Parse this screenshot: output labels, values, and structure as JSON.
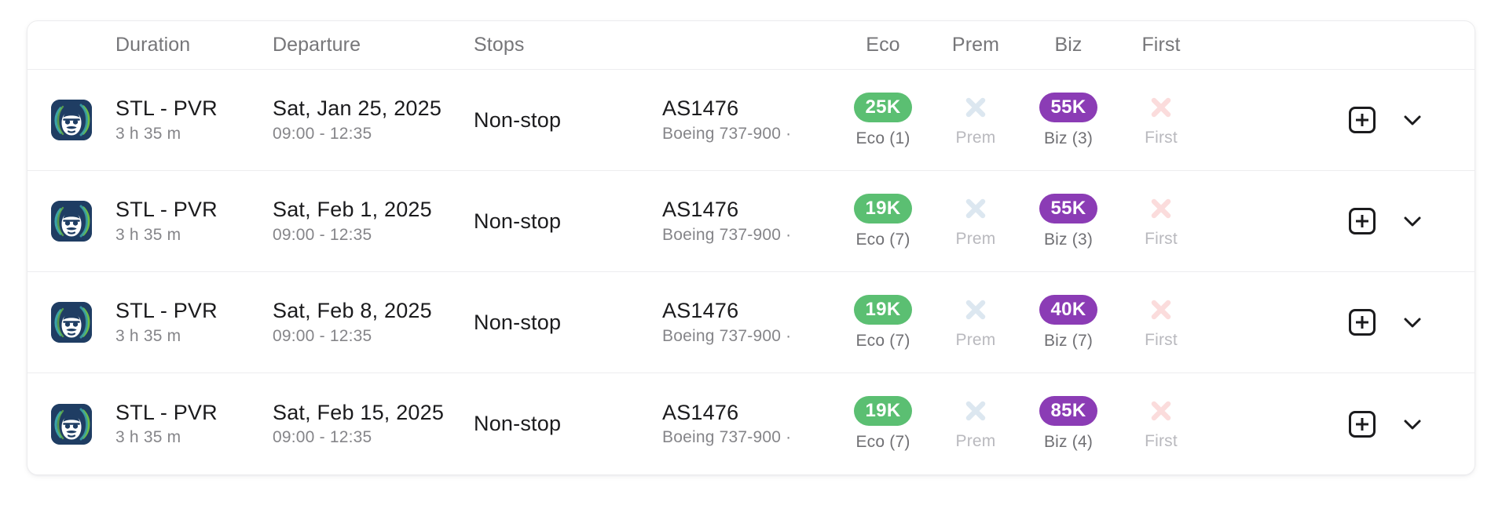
{
  "table": {
    "columns": [
      {
        "key": "logo",
        "label": "",
        "align": "left"
      },
      {
        "key": "duration",
        "label": "Duration",
        "align": "left"
      },
      {
        "key": "departure",
        "label": "Departure",
        "align": "left"
      },
      {
        "key": "stops",
        "label": "Stops",
        "align": "left"
      },
      {
        "key": "flight",
        "label": "",
        "align": "left"
      },
      {
        "key": "eco",
        "label": "Eco",
        "align": "center"
      },
      {
        "key": "prem",
        "label": "Prem",
        "align": "center"
      },
      {
        "key": "biz",
        "label": "Biz",
        "align": "center"
      },
      {
        "key": "first",
        "label": "First",
        "align": "center"
      }
    ],
    "rows": [
      {
        "airline_logo": "alaska-airlines-logo",
        "route": "STL - PVR",
        "duration": "3 h 35 m",
        "date": "Sat, Jan 25, 2025",
        "times": "09:00 - 12:35",
        "stops": "Non-stop",
        "flight_number": "AS1476",
        "aircraft": "Boeing 737-900  ·",
        "eco": {
          "available": true,
          "miles": "25K",
          "label": "Eco (1)"
        },
        "prem": {
          "available": false,
          "miles": "",
          "label": "Prem"
        },
        "biz": {
          "available": true,
          "miles": "55K",
          "label": "Biz (3)"
        },
        "first": {
          "available": false,
          "miles": "",
          "label": "First"
        }
      },
      {
        "airline_logo": "alaska-airlines-logo",
        "route": "STL - PVR",
        "duration": "3 h 35 m",
        "date": "Sat, Feb 1, 2025",
        "times": "09:00 - 12:35",
        "stops": "Non-stop",
        "flight_number": "AS1476",
        "aircraft": "Boeing 737-900  ·",
        "eco": {
          "available": true,
          "miles": "19K",
          "label": "Eco (7)"
        },
        "prem": {
          "available": false,
          "miles": "",
          "label": "Prem"
        },
        "biz": {
          "available": true,
          "miles": "55K",
          "label": "Biz (3)"
        },
        "first": {
          "available": false,
          "miles": "",
          "label": "First"
        }
      },
      {
        "airline_logo": "alaska-airlines-logo",
        "route": "STL - PVR",
        "duration": "3 h 35 m",
        "date": "Sat, Feb 8, 2025",
        "times": "09:00 - 12:35",
        "stops": "Non-stop",
        "flight_number": "AS1476",
        "aircraft": "Boeing 737-900  ·",
        "eco": {
          "available": true,
          "miles": "19K",
          "label": "Eco (7)"
        },
        "prem": {
          "available": false,
          "miles": "",
          "label": "Prem"
        },
        "biz": {
          "available": true,
          "miles": "40K",
          "label": "Biz (7)"
        },
        "first": {
          "available": false,
          "miles": "",
          "label": "First"
        }
      },
      {
        "airline_logo": "alaska-airlines-logo",
        "route": "STL - PVR",
        "duration": "3 h 35 m",
        "date": "Sat, Feb 15, 2025",
        "times": "09:00 - 12:35",
        "stops": "Non-stop",
        "flight_number": "AS1476",
        "aircraft": "Boeing 737-900  ·",
        "eco": {
          "available": true,
          "miles": "19K",
          "label": "Eco (7)"
        },
        "prem": {
          "available": false,
          "miles": "",
          "label": "Prem"
        },
        "biz": {
          "available": true,
          "miles": "85K",
          "label": "Biz (4)"
        },
        "first": {
          "available": false,
          "miles": "",
          "label": "First"
        }
      }
    ],
    "row_actions": {
      "add_icon": "plus-square-icon",
      "expand_icon": "chevron-down-icon"
    }
  },
  "colors": {
    "eco_pill": "#5bbf72",
    "biz_pill": "#8b3cb5",
    "prem_x": "#dce7f0",
    "first_x": "#fbdcdc",
    "card_border": "#ececee",
    "row_divider": "#ededef",
    "text_primary": "#1b1b1d",
    "text_secondary": "#858589",
    "header_text": "#767679",
    "logo_navy": "#1f3d63",
    "logo_teal": "#3aa2a8",
    "logo_green": "#6cbd45"
  }
}
